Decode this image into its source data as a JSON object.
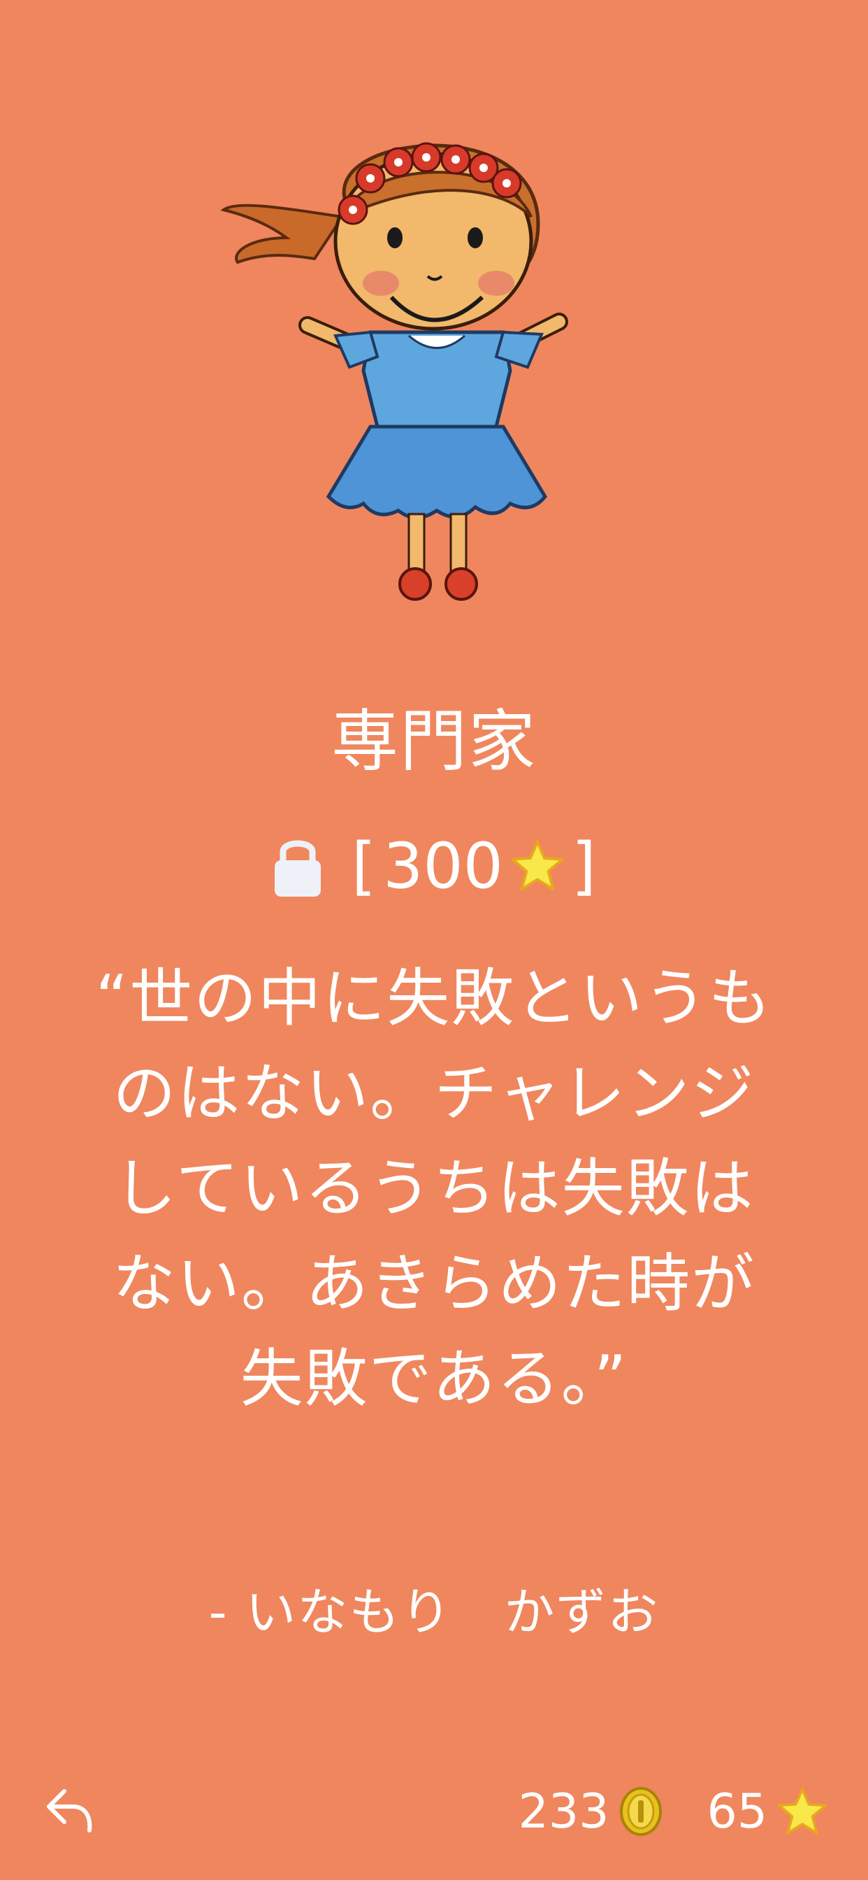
{
  "card": {
    "title": "専門家",
    "price": "300",
    "price_prefix": "[",
    "price_suffix": "]",
    "quote": "“世の中に失敗というものはない。チャレンジしているうちは失敗はない。あきらめた時が失敗である。”",
    "author": "- いなもり　かずお"
  },
  "footer": {
    "coins": "233",
    "stars": "65"
  },
  "icons": {
    "hero": "girl-illustration",
    "lock": "lock-icon",
    "price_star": "star-icon",
    "coin": "coin-icon",
    "stat_star": "star-icon",
    "back": "back-arrow-icon"
  },
  "colors": {
    "background": "#F0865D",
    "text": "#FFFFFF",
    "lock": "#EEF1F8",
    "star": "#F8E84A",
    "coin": "#E8C21C"
  }
}
